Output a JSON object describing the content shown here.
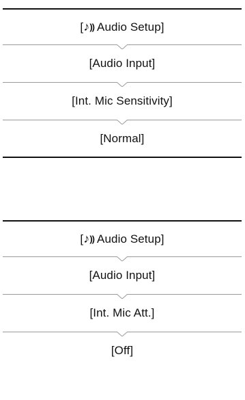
{
  "path_1": {
    "menu": {
      "open_bracket": "[",
      "note_glyph": "♪",
      "waves_glyph": "))",
      "label": "Audio Setup]"
    },
    "step_2": "[Audio Input]",
    "step_3": "[Int. Mic Sensitivity]",
    "step_4": "[Normal]"
  },
  "path_2": {
    "menu": {
      "open_bracket": "[",
      "note_glyph": "♪",
      "waves_glyph": "))",
      "label": "Audio Setup]"
    },
    "step_2": "[Audio Input]",
    "step_3": "[Int. Mic Att.]",
    "step_4": "[Off]"
  },
  "icons": {
    "audio_menu_icon": "music-note-with-sound-waves",
    "separator_icon": "chevron-down"
  }
}
